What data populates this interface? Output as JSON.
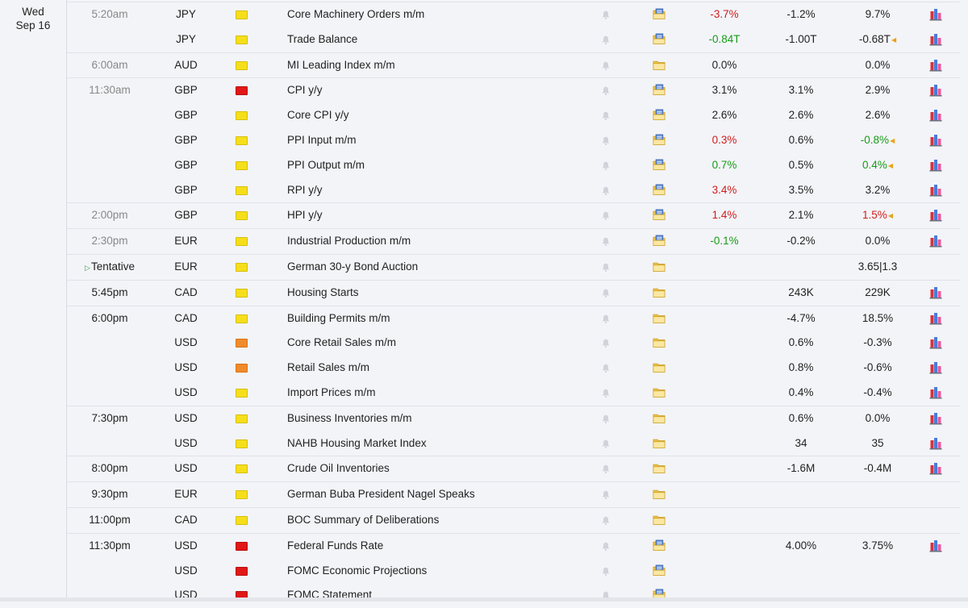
{
  "date": {
    "weekday": "Wed",
    "day": "Sep 16"
  },
  "colors": {
    "green": "#169c16",
    "red": "#d11c1c",
    "impact_high": "#e01818",
    "impact_medium": "#f08b2c",
    "impact_low": "#f5df1c"
  },
  "icons": {
    "bell": "bell-icon",
    "folder": "folder-icon",
    "graph": "graph-icon",
    "revision": "revision-arrow-icon",
    "tentative": "tentative-marker-icon"
  },
  "events": [
    {
      "time": "5:20am",
      "currency": "JPY",
      "impact": "yellow",
      "title": "Core Machinery Orders m/m",
      "actual": "-3.7%",
      "actual_color": "red",
      "forecast": "-1.2%",
      "previous": "9.7%",
      "updated": true,
      "graph": true
    },
    {
      "time": "",
      "currency": "JPY",
      "impact": "yellow",
      "title": "Trade Balance",
      "actual": "-0.84T",
      "actual_color": "green",
      "forecast": "-1.00T",
      "previous": "-0.68T",
      "prev_revised": true,
      "updated": true,
      "graph": true
    },
    {
      "time": "6:00am",
      "currency": "AUD",
      "impact": "yellow",
      "title": "MI Leading Index m/m",
      "actual": "0.0%",
      "forecast": "",
      "previous": "0.0%",
      "updated": false,
      "graph": true
    },
    {
      "time": "11:30am",
      "currency": "GBP",
      "impact": "red",
      "title": "CPI y/y",
      "actual": "3.1%",
      "forecast": "3.1%",
      "previous": "2.9%",
      "updated": true,
      "graph": true
    },
    {
      "time": "",
      "currency": "GBP",
      "impact": "yellow",
      "title": "Core CPI y/y",
      "actual": "2.6%",
      "forecast": "2.6%",
      "previous": "2.6%",
      "updated": true,
      "graph": true
    },
    {
      "time": "",
      "currency": "GBP",
      "impact": "yellow",
      "title": "PPI Input m/m",
      "actual": "0.3%",
      "actual_color": "red",
      "forecast": "0.6%",
      "previous": "-0.8%",
      "prev_color": "green",
      "prev_revised": true,
      "updated": true,
      "graph": true
    },
    {
      "time": "",
      "currency": "GBP",
      "impact": "yellow",
      "title": "PPI Output m/m",
      "actual": "0.7%",
      "actual_color": "green",
      "forecast": "0.5%",
      "previous": "0.4%",
      "prev_color": "green",
      "prev_revised": true,
      "updated": true,
      "graph": true
    },
    {
      "time": "",
      "currency": "GBP",
      "impact": "yellow",
      "title": "RPI y/y",
      "actual": "3.4%",
      "actual_color": "red",
      "forecast": "3.5%",
      "previous": "3.2%",
      "updated": true,
      "graph": true
    },
    {
      "time": "2:00pm",
      "currency": "GBP",
      "impact": "yellow",
      "title": "HPI y/y",
      "actual": "1.4%",
      "actual_color": "red",
      "forecast": "2.1%",
      "previous": "1.5%",
      "prev_color": "red",
      "prev_revised": true,
      "updated": true,
      "graph": true
    },
    {
      "time": "2:30pm",
      "currency": "EUR",
      "impact": "yellow",
      "title": "Industrial Production m/m",
      "actual": "-0.1%",
      "actual_color": "green",
      "forecast": "-0.2%",
      "previous": "0.0%",
      "updated": true,
      "graph": true
    },
    {
      "time": "Tentative",
      "time_dark": true,
      "tentative": true,
      "currency": "EUR",
      "impact": "yellow",
      "title": "German 30-y Bond Auction",
      "actual": "",
      "forecast": "",
      "previous": "3.65|1.3",
      "updated": false,
      "graph": false
    },
    {
      "time": "5:45pm",
      "time_dark": true,
      "currency": "CAD",
      "impact": "yellow",
      "title": "Housing Starts",
      "actual": "",
      "forecast": "243K",
      "previous": "229K",
      "updated": false,
      "graph": true
    },
    {
      "time": "6:00pm",
      "time_dark": true,
      "currency": "CAD",
      "impact": "yellow",
      "title": "Building Permits m/m",
      "actual": "",
      "forecast": "-4.7%",
      "previous": "18.5%",
      "updated": false,
      "graph": true
    },
    {
      "time": "",
      "currency": "USD",
      "impact": "orange",
      "title": "Core Retail Sales m/m",
      "actual": "",
      "forecast": "0.6%",
      "previous": "-0.3%",
      "updated": false,
      "graph": true
    },
    {
      "time": "",
      "currency": "USD",
      "impact": "orange",
      "title": "Retail Sales m/m",
      "actual": "",
      "forecast": "0.8%",
      "previous": "-0.6%",
      "updated": false,
      "graph": true
    },
    {
      "time": "",
      "currency": "USD",
      "impact": "yellow",
      "title": "Import Prices m/m",
      "actual": "",
      "forecast": "0.4%",
      "previous": "-0.4%",
      "updated": false,
      "graph": true
    },
    {
      "time": "7:30pm",
      "time_dark": true,
      "currency": "USD",
      "impact": "yellow",
      "title": "Business Inventories m/m",
      "actual": "",
      "forecast": "0.6%",
      "previous": "0.0%",
      "updated": false,
      "graph": true
    },
    {
      "time": "",
      "currency": "USD",
      "impact": "yellow",
      "title": "NAHB Housing Market Index",
      "actual": "",
      "forecast": "34",
      "previous": "35",
      "updated": false,
      "graph": true
    },
    {
      "time": "8:00pm",
      "time_dark": true,
      "currency": "USD",
      "impact": "yellow",
      "title": "Crude Oil Inventories",
      "actual": "",
      "forecast": "-1.6M",
      "previous": "-0.4M",
      "updated": false,
      "graph": true
    },
    {
      "time": "9:30pm",
      "time_dark": true,
      "currency": "EUR",
      "impact": "yellow",
      "title": "German Buba President Nagel Speaks",
      "actual": "",
      "forecast": "",
      "previous": "",
      "updated": false,
      "graph": false
    },
    {
      "time": "11:00pm",
      "time_dark": true,
      "currency": "CAD",
      "impact": "yellow",
      "title": "BOC Summary of Deliberations",
      "actual": "",
      "forecast": "",
      "previous": "",
      "updated": false,
      "graph": false
    },
    {
      "time": "11:30pm",
      "time_dark": true,
      "currency": "USD",
      "impact": "red",
      "title": "Federal Funds Rate",
      "actual": "",
      "forecast": "4.00%",
      "previous": "3.75%",
      "updated": true,
      "graph": true
    },
    {
      "time": "",
      "currency": "USD",
      "impact": "red",
      "title": "FOMC Economic Projections",
      "actual": "",
      "forecast": "",
      "previous": "",
      "updated": true,
      "graph": false
    },
    {
      "time": "",
      "currency": "USD",
      "impact": "red",
      "title": "FOMC Statement",
      "actual": "",
      "forecast": "",
      "previous": "",
      "updated": true,
      "graph": false
    }
  ]
}
